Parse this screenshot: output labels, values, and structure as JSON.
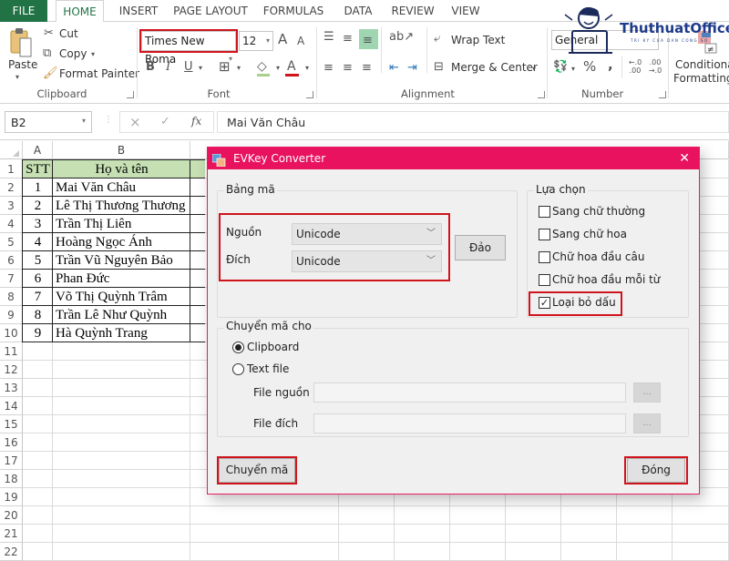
{
  "ribbon": {
    "tabs": [
      "FILE",
      "HOME",
      "INSERT",
      "PAGE LAYOUT",
      "FORMULAS",
      "DATA",
      "REVIEW",
      "VIEW"
    ],
    "active_tab": "HOME",
    "clipboard": {
      "paste": "Paste",
      "cut": "Cut",
      "copy": "Copy",
      "format_painter": "Format Painter",
      "label": "Clipboard"
    },
    "font": {
      "name": "Times New Roma",
      "size": "12",
      "bold": "B",
      "italic": "I",
      "underline": "U",
      "grow": "A",
      "shrink": "A",
      "color_glyph": "A",
      "label": "Font"
    },
    "alignment": {
      "wrap_text": "Wrap Text",
      "merge_center": "Merge & Center",
      "label": "Alignment"
    },
    "number": {
      "format": "General",
      "percent": "%",
      "comma": ",",
      "inc_decimal": "←.0 .00",
      "dec_decimal": ".00 →.0",
      "label": "Number"
    },
    "styles": {
      "conditional_formatting_1": "Conditional",
      "conditional_formatting_2": "Formatting"
    }
  },
  "watermark": {
    "brand": "ThuthuatOffice",
    "tagline": "TRI KY CUA DAN CONG SO"
  },
  "formula_bar": {
    "name_box": "B2",
    "cancel": "×",
    "enter": "✓",
    "fx": "fx",
    "content": "Mai Văn Châu"
  },
  "sheet": {
    "columns": [
      "A",
      "B"
    ],
    "rows": [
      "1",
      "2",
      "3",
      "4",
      "5",
      "6",
      "7",
      "8",
      "9",
      "10",
      "11",
      "12",
      "13",
      "14",
      "15",
      "16",
      "17",
      "18",
      "19",
      "20",
      "21",
      "22"
    ],
    "header": {
      "stt": "STT",
      "name": "Họ và tên"
    },
    "data": [
      {
        "stt": "1",
        "name": "Mai Văn Châu"
      },
      {
        "stt": "2",
        "name": "Lê Thị Thương Thương"
      },
      {
        "stt": "3",
        "name": "Trần Thị Liên"
      },
      {
        "stt": "4",
        "name": "Hoàng Ngọc Ánh"
      },
      {
        "stt": "5",
        "name": "Trần Vũ Nguyên Bảo"
      },
      {
        "stt": "6",
        "name": "Phan Đức"
      },
      {
        "stt": "7",
        "name": "Võ Thị Quỳnh Trâm"
      },
      {
        "stt": "8",
        "name": "Trần Lê Như Quỳnh"
      },
      {
        "stt": "9",
        "name": "Hà Quỳnh Trang"
      }
    ],
    "header_fill": "#c6e0b4"
  },
  "dialog": {
    "title": "EVKey Converter",
    "close": "✕",
    "encoding_group": "Bảng mã",
    "source_label": "Nguồn",
    "source_value": "Unicode",
    "target_label": "Đích",
    "target_value": "Unicode",
    "swap_button": "Đảo",
    "options_group": "Lựa chọn",
    "options": [
      {
        "label": "Sang chữ thường",
        "checked": false
      },
      {
        "label": "Sang chữ hoa",
        "checked": false
      },
      {
        "label": "Chữ hoa đầu câu",
        "checked": false
      },
      {
        "label": "Chữ hoa đầu mỗi từ",
        "checked": false
      },
      {
        "label": "Loại bỏ dấu",
        "checked": true
      }
    ],
    "convert_for_group": "Chuyển mã cho",
    "radio_clipboard": "Clipboard",
    "radio_textfile": "Text file",
    "selected_mode": "Clipboard",
    "file_source_label": "File nguồn",
    "file_target_label": "File đích",
    "browse": "...",
    "convert_button": "Chuyển mã",
    "close_button": "Đóng",
    "title_color": "#e8125e",
    "highlight_color": "#d0141c"
  }
}
